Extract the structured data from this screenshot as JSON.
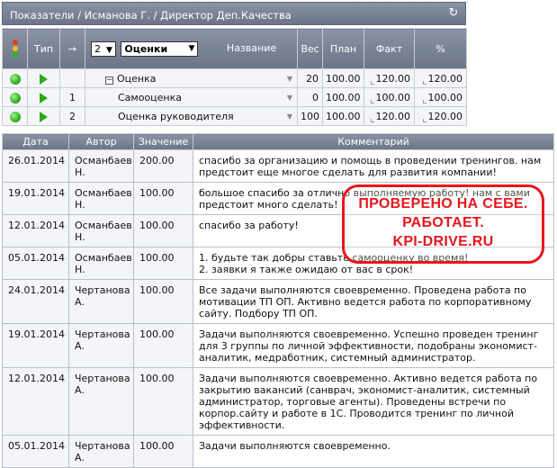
{
  "header": {
    "title": "Показатели / Исманова Г. / Директор Деп.Качества",
    "refresh_icon": "refresh-icon"
  },
  "kpi_table": {
    "columns": {
      "type": "Тип",
      "arrow": "→",
      "level_select": "2",
      "group_select": "Оценки",
      "name": "Название",
      "weight": "Вес",
      "plan": "План",
      "fact": "Факт",
      "percent": "%"
    },
    "rows": [
      {
        "index": "",
        "name": "Оценка",
        "weight": "20",
        "plan": "100.00",
        "fact": "120.00",
        "percent": "120.00",
        "expandable": true
      },
      {
        "index": "1",
        "name": "Самооценка",
        "weight": "0",
        "plan": "100.00",
        "fact": "100.00",
        "percent": "100.00",
        "expandable": false
      },
      {
        "index": "2",
        "name": "Оценка руководителя",
        "weight": "100",
        "plan": "100.00",
        "fact": "120.00",
        "percent": "120.00",
        "expandable": false
      }
    ],
    "status_color": "#25a414"
  },
  "comments_table": {
    "columns": {
      "date": "Дата",
      "author": "Автор",
      "value": "Значение",
      "comment": "Комментарий"
    },
    "rows": [
      {
        "date": "26.01.2014",
        "author": "Османбаев Н.",
        "value": "200.00",
        "comment": "спасибо за организацию и помощь в проведении тренингов. нам предстоит еще многое сделать для развития компании!"
      },
      {
        "date": "19.01.2014",
        "author": "Османбаев Н.",
        "value": "100.00",
        "comment": "большое спасибо за отлично выполняемую работу! нам с вами предстоит много сделать!"
      },
      {
        "date": "12.01.2014",
        "author": "Османбаев Н.",
        "value": "100.00",
        "comment": "спасибо за работу!"
      },
      {
        "date": "05.01.2014",
        "author": "Османбаев Н.",
        "value": "100.00",
        "comment": "1. будьте так добры ставьте самооценку во время!\n2. заявки я также ожидаю от вас в срок!"
      },
      {
        "date": "24.01.2014",
        "author": "Чертанова А.",
        "value": "100.00",
        "comment": "Все задачи выполняются своевременно. Проведена работа по мотивации ТП ОП. Активно ведется работа по корпоративному сайту. Подбору ТП ОП."
      },
      {
        "date": "19.01.2014",
        "author": "Чертанова А.",
        "value": "100.00",
        "comment": "Задачи выполняются своевременно. Успешно проведен тренинг для 3 группы по личной эффективности, подобраны экономист-аналитик, медработник, системный администратор."
      },
      {
        "date": "12.01.2014",
        "author": "Чертанова А.",
        "value": "100.00",
        "comment": "Задачи выполняются своевременно. Активно ведется работа по закрытию вакансий (санврач, экономист-аналитик, системный администратор, торговые агенты). Проведены встречи по корпор.сайту и работе в 1С. Проводится тренинг по личной эффективности."
      },
      {
        "date": "05.01.2014",
        "author": "Чертанова А.",
        "value": "100.00",
        "comment": "Задачи выполняются своевременно."
      }
    ]
  },
  "stamp": {
    "line1": "ПРОВЕРЕНО НА СЕБЕ.",
    "line2": "РАБОТАЕТ.",
    "line3": "KPI-DRIVE.RU",
    "color": "#e8161d"
  }
}
